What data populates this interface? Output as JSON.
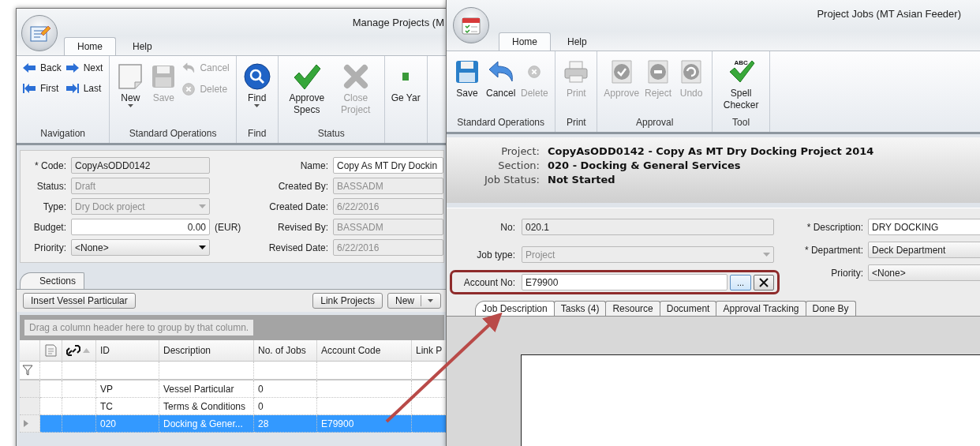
{
  "manage_window": {
    "title": "Manage Projects (M",
    "ribbon_tabs": [
      {
        "label": "Home",
        "selected": true
      },
      {
        "label": "Help",
        "selected": false
      }
    ],
    "ribbon_groups": [
      {
        "label": "Navigation",
        "buttons": [
          {
            "label": "Back",
            "kind": "small",
            "disabled": false
          },
          {
            "label": "First",
            "kind": "small",
            "disabled": false
          },
          {
            "label": "Next",
            "kind": "small",
            "disabled": false
          },
          {
            "label": "Last",
            "kind": "small",
            "disabled": false
          }
        ]
      },
      {
        "label": "Standard Operations",
        "buttons": [
          {
            "label": "New",
            "kind": "large",
            "disabled": false,
            "dropdown": true
          },
          {
            "label": "Save",
            "kind": "large",
            "disabled": true,
            "dropdown": false
          },
          {
            "label": "Cancel",
            "kind": "small",
            "disabled": true
          },
          {
            "label": "Delete",
            "kind": "small",
            "disabled": true
          }
        ]
      },
      {
        "label": "Find",
        "buttons": [
          {
            "label": "Find",
            "kind": "large",
            "disabled": false,
            "dropdown": true
          }
        ]
      },
      {
        "label": "Status",
        "buttons": [
          {
            "label": "Approve Specs",
            "kind": "large",
            "disabled": false,
            "dropdown": false
          },
          {
            "label": "Close Project",
            "kind": "large",
            "disabled": true,
            "dropdown": false
          }
        ]
      },
      {
        "buttons": [
          {
            "label": "Ge Yar",
            "kind": "large",
            "disabled": false,
            "dropdown": false
          }
        ]
      }
    ],
    "left_fields": [
      {
        "label": "* Code:",
        "value": "CopyAsODD0142",
        "kind": "text",
        "readonly": true,
        "disabled": false
      },
      {
        "label": "Status:",
        "value": "Draft",
        "kind": "text",
        "readonly": true,
        "disabled": true
      },
      {
        "label": "Type:",
        "value": "Dry Dock project",
        "kind": "dropdown",
        "readonly": true,
        "disabled": true
      },
      {
        "label": "Budget:",
        "value": "0.00",
        "kind": "number",
        "readonly": false,
        "disabled": false,
        "suffix": "(EUR)"
      },
      {
        "label": "Priority:",
        "value": "<None>",
        "kind": "dropdown",
        "readonly": false,
        "disabled": false
      }
    ],
    "right_fields": [
      {
        "label": "Name:",
        "value": "Copy As MT Dry Dockin",
        "kind": "text",
        "readonly": false,
        "disabled": false
      },
      {
        "label": "Created By:",
        "value": "BASSADM",
        "kind": "text",
        "readonly": true,
        "disabled": true
      },
      {
        "label": "Created Date:",
        "value": "6/22/2016",
        "kind": "text",
        "readonly": true,
        "disabled": true
      },
      {
        "label": "Revised By:",
        "value": "BASSADM",
        "kind": "text",
        "readonly": true,
        "disabled": true
      },
      {
        "label": "Revised  Date:",
        "value": "6/22/2016",
        "kind": "text",
        "readonly": true,
        "disabled": true
      }
    ],
    "section_tabs": [
      {
        "label": "Sections",
        "selected": true
      }
    ],
    "toolbar_buttons": [
      {
        "label": "Insert Vessel Particular",
        "kind": "button"
      },
      {
        "label": "Link Projects",
        "kind": "button"
      },
      {
        "label": "New",
        "kind": "split"
      }
    ],
    "group_by_hint": "Drag a column header here to group by that column.",
    "columns": [
      {
        "kind": "indicator"
      },
      {
        "kind": "icon"
      },
      {
        "kind": "icon",
        "sorted": true
      },
      {
        "kind": "text",
        "label": "ID"
      },
      {
        "kind": "text",
        "label": "Description"
      },
      {
        "kind": "text",
        "label": "No. of Jobs"
      },
      {
        "kind": "text",
        "label": "Account Code"
      },
      {
        "kind": "text",
        "label": "Link P"
      }
    ],
    "rows": [
      {
        "id": "VP",
        "description": "Vessel Particular",
        "jobs": "0",
        "selected": false
      },
      {
        "id": "TC",
        "description": "Terms & Conditions",
        "jobs": "0",
        "selected": false
      },
      {
        "id": "020",
        "description": "Docking & Gener...",
        "jobs": "28",
        "account": "E79900",
        "selected": true
      }
    ]
  },
  "jobs_window": {
    "title": "Project Jobs (MT Asian Feeder)",
    "ribbon_tabs": [
      {
        "label": "Home",
        "selected": true
      },
      {
        "label": "Help",
        "selected": false
      }
    ],
    "ribbon_groups": [
      {
        "label": "Standard Operations",
        "buttons": [
          {
            "label": "Save",
            "kind": "large",
            "disabled": false
          },
          {
            "label": "Cancel",
            "kind": "large",
            "disabled": false
          },
          {
            "label": "Delete",
            "kind": "large",
            "disabled": true
          }
        ]
      },
      {
        "label": "Print",
        "buttons": [
          {
            "label": "Print",
            "kind": "large",
            "disabled": true
          }
        ]
      },
      {
        "label": "Approval",
        "buttons": [
          {
            "label": "Approve",
            "kind": "large",
            "disabled": true
          },
          {
            "label": "Reject",
            "kind": "large",
            "disabled": true
          },
          {
            "label": "Undo",
            "kind": "large",
            "disabled": true
          }
        ]
      },
      {
        "label": "Tool",
        "buttons": [
          {
            "label": "Spell Checker",
            "kind": "large",
            "disabled": false,
            "badge": "ABC"
          }
        ]
      }
    ],
    "info": [
      {
        "label": "Project:",
        "value": "CopyAsODD0142 - Copy As MT Dry Docking Project 2014"
      },
      {
        "label": "Section:",
        "value": "020 - Docking & General Services"
      },
      {
        "label": "Job Status:",
        "value": "Not Started"
      }
    ],
    "left_fields": [
      {
        "label": "No:",
        "value": "020.1",
        "kind": "text",
        "readonly": true,
        "disabled": false
      },
      {
        "label": "Job type:",
        "value": "Project",
        "kind": "dropdown",
        "readonly": true,
        "disabled": true
      },
      {
        "label": "Account No:",
        "value": "E79900",
        "kind": "lookup",
        "readonly": false,
        "disabled": false,
        "highlighted": true,
        "button": "..."
      }
    ],
    "right_fields": [
      {
        "label": "* Description:",
        "value": "DRY DOCKING",
        "kind": "text",
        "readonly": false,
        "disabled": false
      },
      {
        "label": "* Department:",
        "value": "Deck Department",
        "kind": "picklist",
        "readonly": false,
        "disabled": false
      },
      {
        "label": "Priority:",
        "value": "<None>",
        "kind": "picklist",
        "readonly": false,
        "disabled": false
      }
    ],
    "detail_tabs": [
      {
        "label": "Job Description",
        "selected": true
      },
      {
        "label": "Tasks (4)",
        "selected": false
      },
      {
        "label": "Resource",
        "selected": false
      },
      {
        "label": "Document",
        "selected": false
      },
      {
        "label": "Approval Tracking",
        "selected": false
      },
      {
        "label": "Done By",
        "selected": false
      }
    ]
  }
}
